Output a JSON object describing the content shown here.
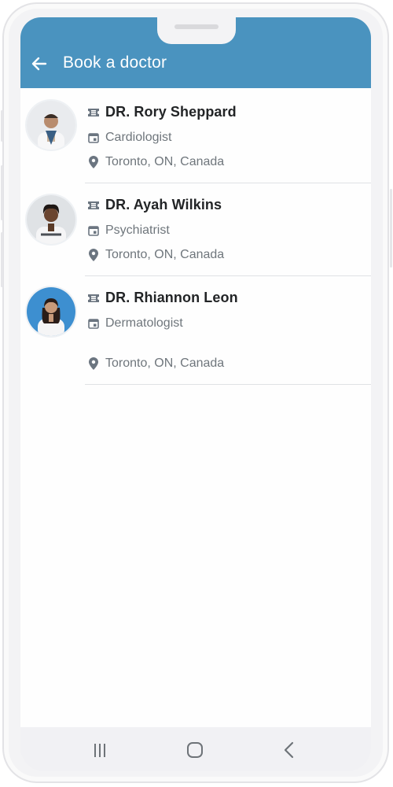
{
  "header": {
    "title": "Book a doctor",
    "background": "#4a93bf",
    "back_icon": "arrow-left-icon"
  },
  "doctors": [
    {
      "name": "DR. Rory Sheppard",
      "specialty": "Cardiologist",
      "location": "Toronto, ON, Canada"
    },
    {
      "name": "DR. Ayah Wilkins",
      "specialty": "Psychiatrist",
      "location": "Toronto, ON, Canada"
    },
    {
      "name": "DR. Rhiannon Leon",
      "specialty": "Dermatologist",
      "location": "Toronto, ON, Canada"
    }
  ],
  "icons": {
    "name": "ticket-icon",
    "specialty": "calendar-icon",
    "location": "location-pin-icon"
  },
  "navbar": {
    "buttons": [
      "recent-apps-icon",
      "home-icon",
      "back-icon"
    ]
  }
}
